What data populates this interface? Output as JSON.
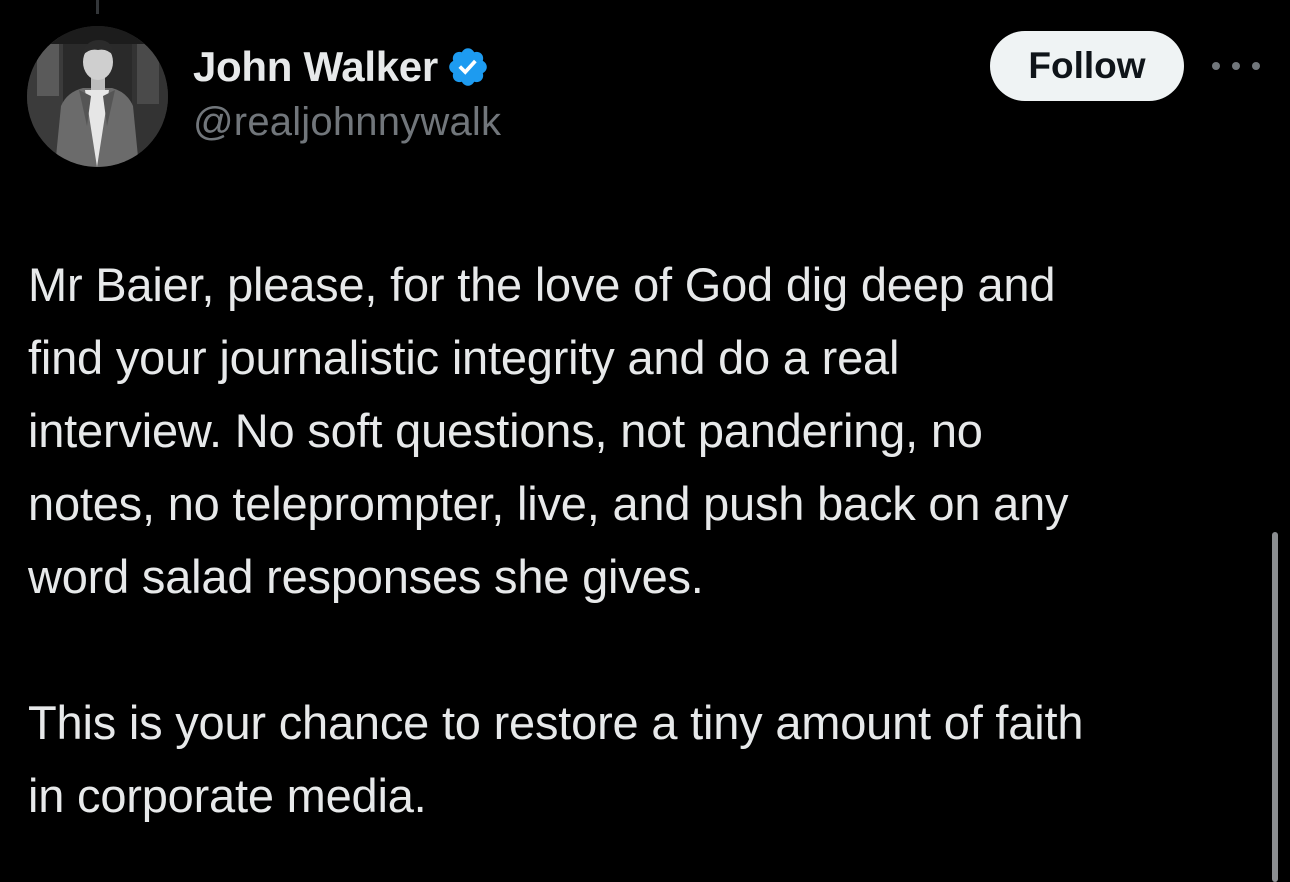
{
  "author": {
    "display_name": "John Walker",
    "handle": "@realjohnnywalk",
    "verified": true,
    "verified_color": "#1d9bf0",
    "avatar_icon": "profile-photo"
  },
  "actions": {
    "follow_label": "Follow",
    "more_icon": "more-options-icon"
  },
  "tweet": {
    "paragraphs": [
      "Mr Baier, please, for the love of God dig deep and\nfind your journalistic integrity and do a real\ninterview. No soft questions, not pandering, no\nnotes, no teleprompter, live, and push back on any\nword salad responses she gives.",
      "This is your chance to restore a tiny amount of faith\nin corporate media."
    ]
  },
  "colors": {
    "background": "#000000",
    "text_primary": "#e7e9ea",
    "text_secondary": "#71767b",
    "follow_button_bg": "#eff3f4",
    "follow_button_text": "#0f1419"
  }
}
